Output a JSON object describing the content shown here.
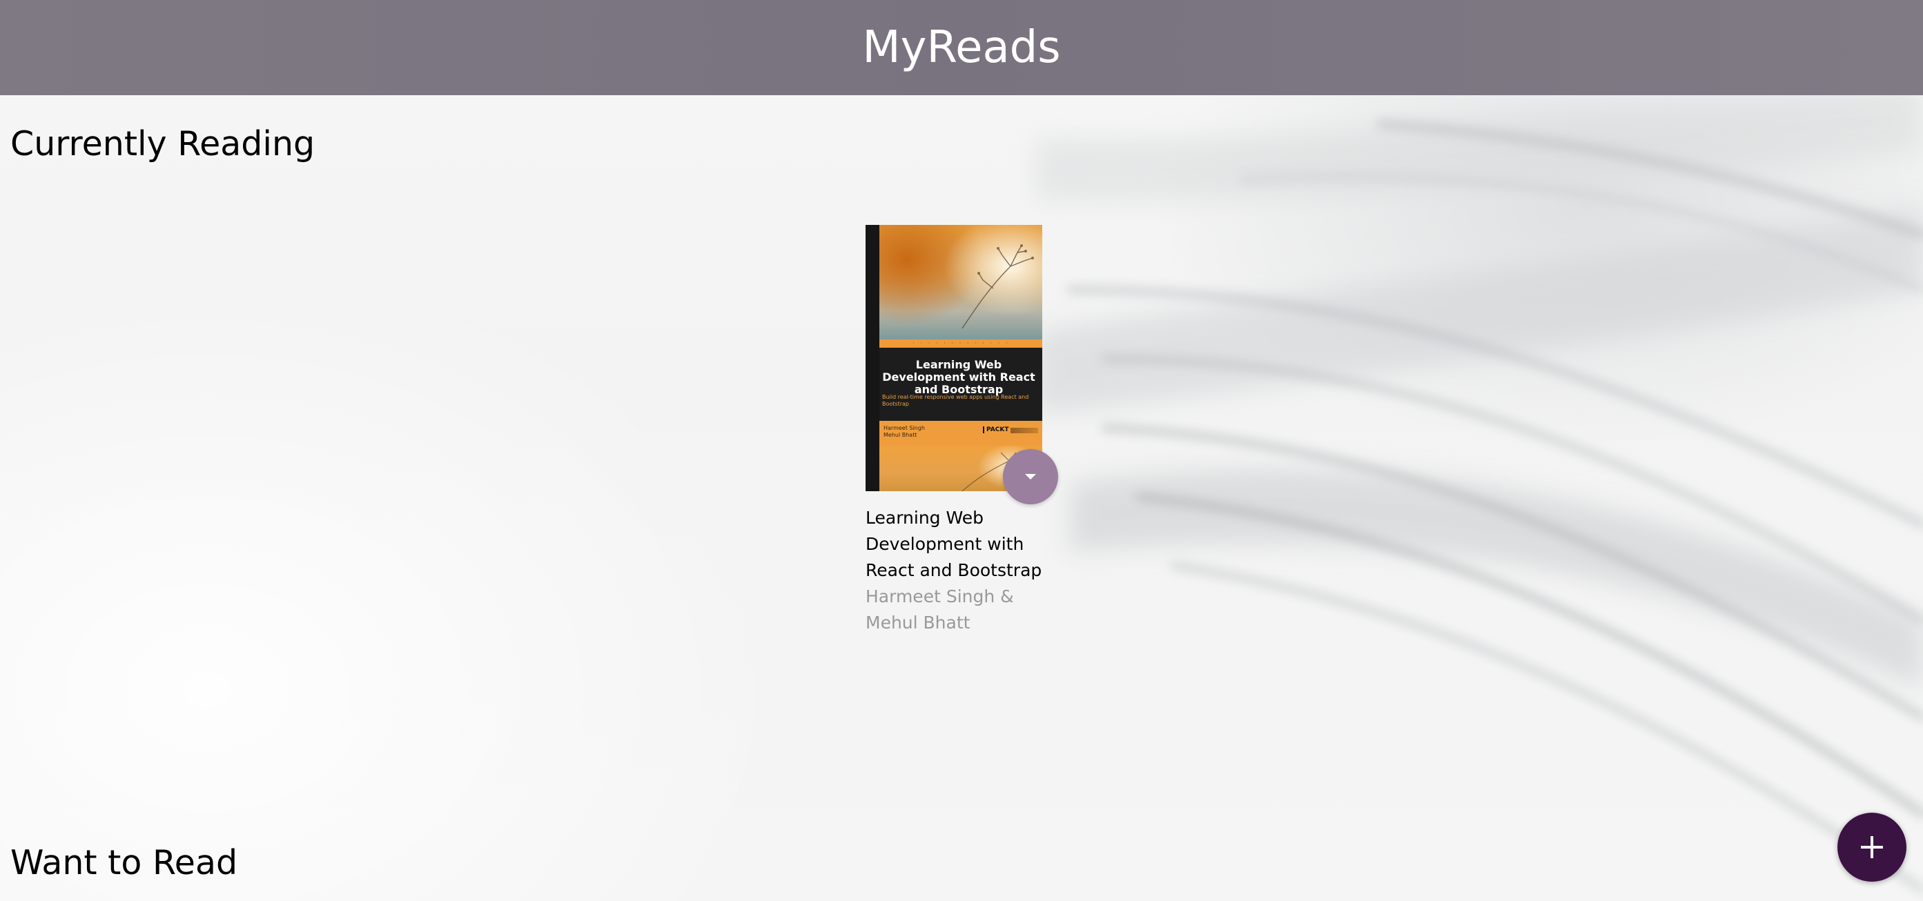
{
  "header": {
    "title": "MyReads"
  },
  "shelves": [
    {
      "title": "Currently Reading",
      "books": [
        {
          "title": "Learning Web Development with React and Bootstrap",
          "authors": "Harmeet Singh & Mehul Bhatt",
          "cover": {
            "title": "Learning Web Development with React and Bootstrap",
            "subtitle": "Build real-time responsive web apps using React and Bootstrap",
            "authors": [
              "Harmeet Singh",
              "Mehul Bhatt"
            ],
            "publisher": "PACKT"
          }
        }
      ]
    },
    {
      "title": "Want to Read",
      "books": []
    }
  ],
  "icons": {
    "shelf_changer": "caret-down-icon",
    "open_search": "plus-icon"
  },
  "colors": {
    "header_bg": "#7b7581",
    "shelf_changer_bg": "#9a7f9e",
    "open_search_bg": "#3a1342",
    "author_text": "#999999"
  }
}
